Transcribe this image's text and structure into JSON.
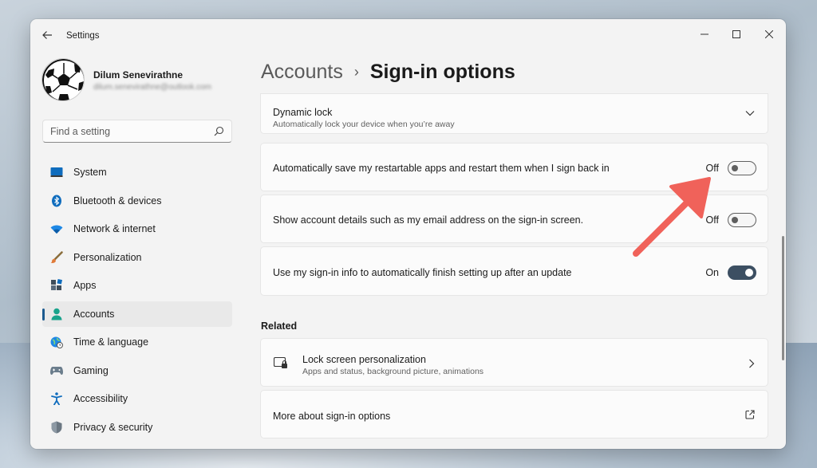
{
  "window": {
    "title": "Settings"
  },
  "user": {
    "name": "Dilum Senevirathne",
    "email": "dilum.senevirathne@outlook.com"
  },
  "search": {
    "placeholder": "Find a setting"
  },
  "nav": {
    "items": [
      {
        "label": "System",
        "icon": "system-icon"
      },
      {
        "label": "Bluetooth & devices",
        "icon": "bluetooth-icon"
      },
      {
        "label": "Network & internet",
        "icon": "wifi-icon"
      },
      {
        "label": "Personalization",
        "icon": "brush-icon"
      },
      {
        "label": "Apps",
        "icon": "apps-icon"
      },
      {
        "label": "Accounts",
        "icon": "accounts-icon",
        "active": true
      },
      {
        "label": "Time & language",
        "icon": "globe-clock-icon"
      },
      {
        "label": "Gaming",
        "icon": "gamepad-icon"
      },
      {
        "label": "Accessibility",
        "icon": "accessibility-icon"
      },
      {
        "label": "Privacy & security",
        "icon": "shield-icon"
      }
    ]
  },
  "breadcrumb": {
    "parent": "Accounts",
    "separator": "›",
    "current": "Sign-in options"
  },
  "settings": {
    "dynamic_lock": {
      "title": "Dynamic lock",
      "subtitle": "Automatically lock your device when you’re away"
    },
    "restart_apps": {
      "title": "Automatically save my restartable apps and restart them when I sign back in",
      "state": "Off"
    },
    "account_details": {
      "title": "Show account details such as my email address on the sign-in screen.",
      "state": "Off"
    },
    "signin_info": {
      "title": "Use my sign-in info to automatically finish setting up after an update",
      "state": "On"
    }
  },
  "related": {
    "label": "Related",
    "lock_screen": {
      "title": "Lock screen personalization",
      "subtitle": "Apps and status, background picture, animations"
    },
    "more_about": {
      "title": "More about sign-in options"
    }
  },
  "colors": {
    "accent": "#1b5a8f",
    "toggle_on": "#3c4f62",
    "annotation_arrow": "#f0625a"
  }
}
